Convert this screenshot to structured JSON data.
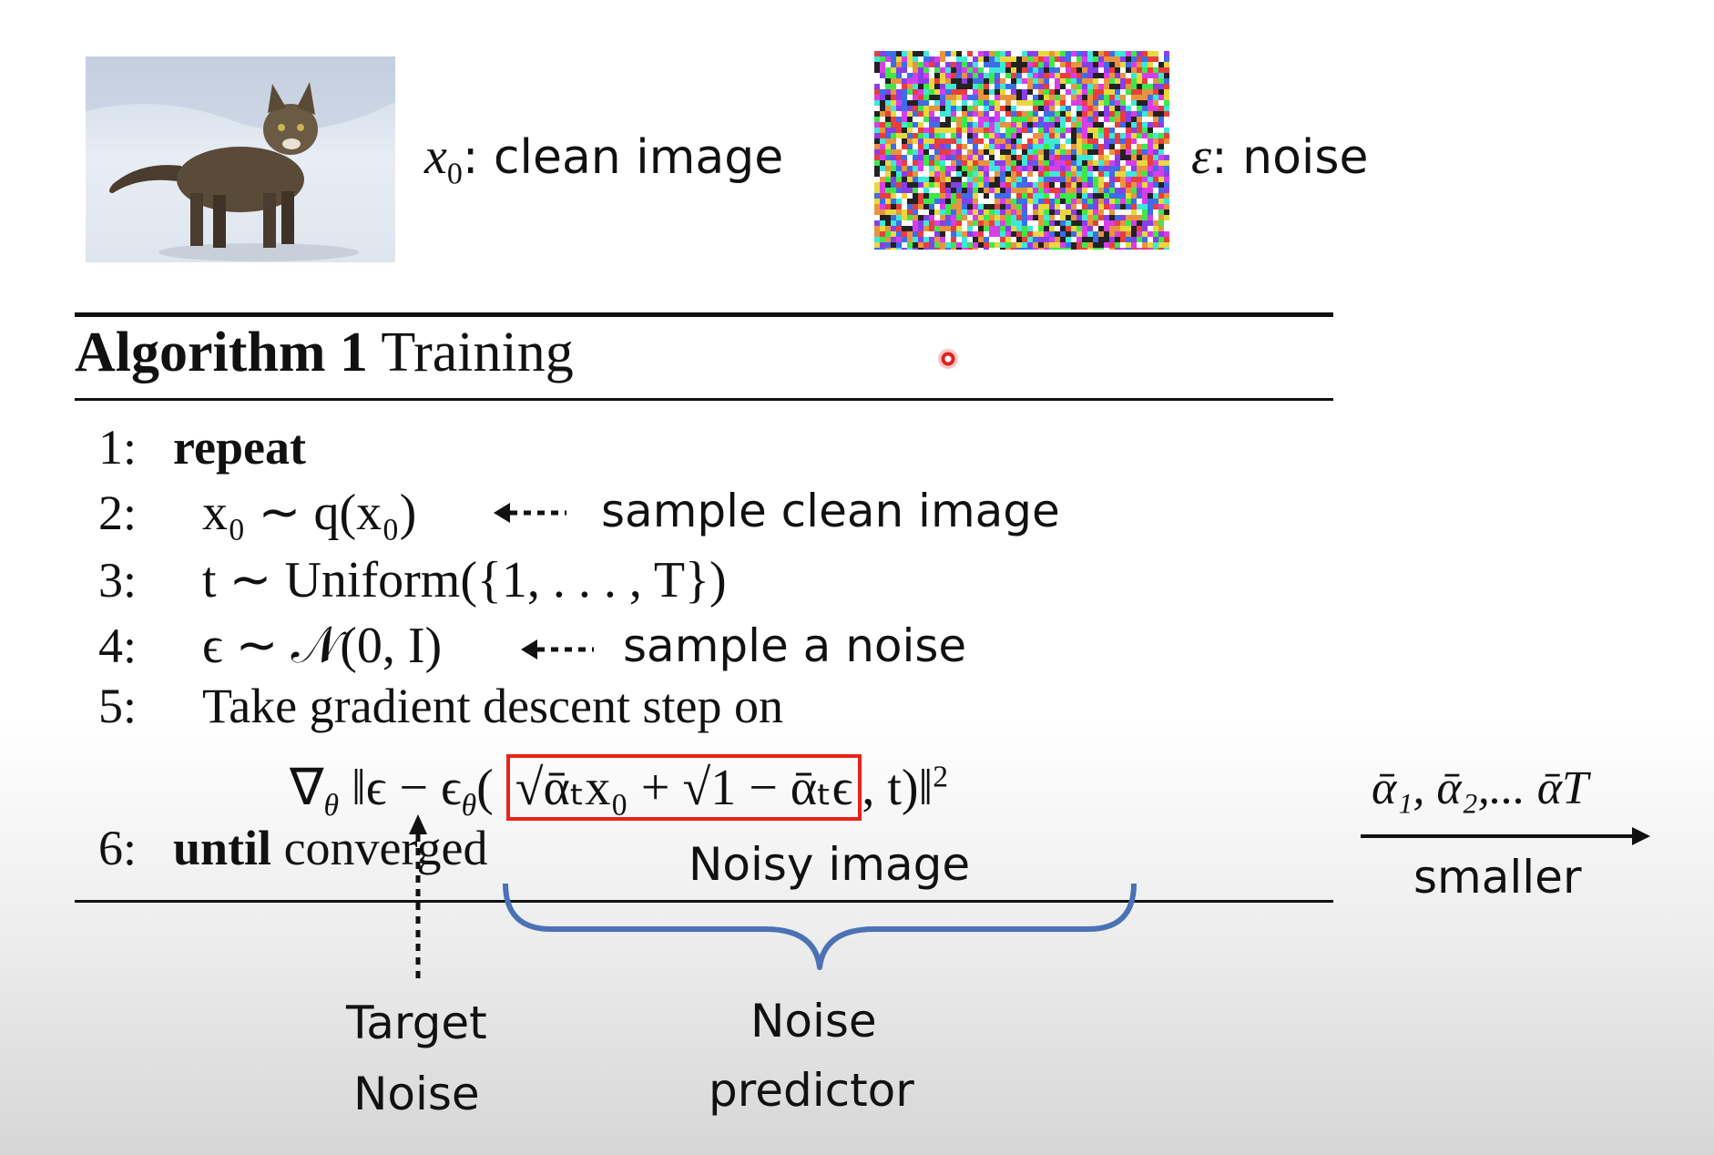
{
  "top": {
    "clean_var": "x",
    "clean_sub": "0",
    "clean_label": ": clean image",
    "noise_var": "ε",
    "noise_label": ": noise"
  },
  "algorithm": {
    "title_bold": "Algorithm 1",
    "title_rest": "Training",
    "lines": [
      {
        "num": "1:",
        "text": "repeat"
      },
      {
        "num": "2:",
        "text": "x₀ ∼ q(x₀)"
      },
      {
        "num": "3:",
        "text": "t ∼ Uniform({1, . . . , T})"
      },
      {
        "num": "4:",
        "text": "ϵ ∼ 𝒩(0, I)"
      },
      {
        "num": "5:",
        "text": "Take gradient descent step on"
      },
      {
        "num": "6:",
        "until": "until",
        "rest": "converged"
      }
    ],
    "formula": {
      "nabla": "∇",
      "theta": "θ",
      "part1": "‖ϵ − ϵ",
      "boxed": "√ᾱₜx₀ + √1 − ᾱₜϵ",
      "tail": ", t)‖",
      "sup": "2"
    }
  },
  "annotations": {
    "sample_clean": "sample clean image",
    "sample_noise": "sample a noise",
    "noisy_image": "Noisy image",
    "target_noise_1": "Target",
    "target_noise_2": "Noise",
    "noise_predictor_1": "Noise",
    "noise_predictor_2": "predictor",
    "alpha_seq": "ᾱ₁, ᾱ₂,... ᾱT",
    "smaller": "smaller"
  },
  "colors": {
    "red_box": "#e8231a",
    "brace": "#4a72b5",
    "cursor": "#e02020"
  }
}
